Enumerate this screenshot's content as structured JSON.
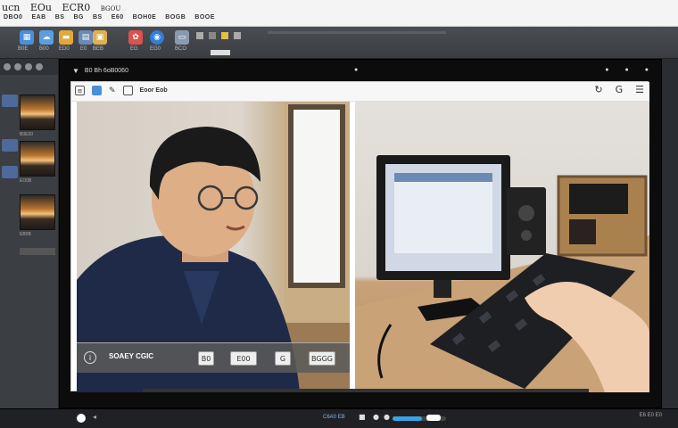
{
  "app": {
    "title_words": [
      "ucn",
      "EOu",
      "ECR0",
      "BGOU"
    ]
  },
  "menu": {
    "items": [
      "DBO0",
      "EAB",
      "BS",
      "BG",
      "BS",
      "E60",
      "BOH0E",
      "BOGB",
      "BOOE"
    ]
  },
  "toolbar": {
    "buttons": [
      {
        "icon": "film-icon",
        "label": "B0E",
        "color": "#4a90d9"
      },
      {
        "icon": "cloud-icon",
        "label": "B00",
        "color": "#5aa0e0"
      },
      {
        "icon": "folder-icon",
        "label": "ED0",
        "color": "#e3a83c"
      },
      {
        "icon": "grid-icon",
        "label": "E0",
        "color": "#6b8bb5"
      },
      {
        "icon": "image-icon",
        "label": "BEB",
        "color": "#e0b050"
      },
      {
        "icon": "palette-icon",
        "label": "EG",
        "color": "#d9534f"
      },
      {
        "icon": "globe-icon",
        "label": "EG0",
        "color": "#2f7ed8"
      },
      {
        "icon": "window-icon",
        "label": "BCO",
        "color": "#8a9bb0"
      }
    ]
  },
  "left_panel": {
    "thumb_labels": [
      "B0E00",
      "EO0B",
      "EB0B"
    ]
  },
  "viewer": {
    "title": "B0 Bh 6oB0060",
    "right_icons": [
      "settings-icon",
      "info-icon",
      "close-icon"
    ]
  },
  "doc": {
    "toolbar_text": "Eoor Eob",
    "caption": "SOAEY CGIC",
    "caption_buttons": [
      "B0",
      "E00",
      "G",
      "BGGG"
    ]
  },
  "bottom": {
    "time_label": "C6A0 EB",
    "progress_fraction": 0.55,
    "right_label": "E6  E0 E0"
  },
  "colors": {
    "accent": "#3aa3e8",
    "toolbar_bg": "#3a3d42",
    "viewer_bg": "#0c0c0d"
  }
}
